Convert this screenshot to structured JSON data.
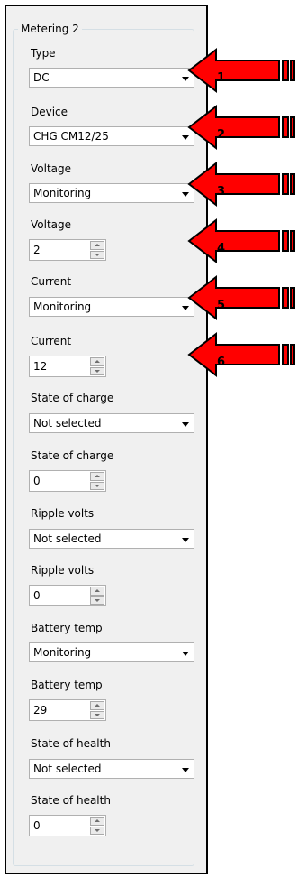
{
  "group": {
    "title": "Metering 2"
  },
  "fields": [
    {
      "label": "Type",
      "kind": "combo",
      "value": "DC"
    },
    {
      "label": "Device",
      "kind": "combo",
      "value": "CHG CM12/25"
    },
    {
      "label": "Voltage",
      "kind": "combo",
      "value": "Monitoring"
    },
    {
      "label": "Voltage",
      "kind": "spin",
      "value": "2"
    },
    {
      "label": "Current",
      "kind": "combo",
      "value": "Monitoring"
    },
    {
      "label": "Current",
      "kind": "spin",
      "value": "12"
    },
    {
      "label": "State of charge",
      "kind": "combo",
      "value": "Not selected"
    },
    {
      "label": "State of charge",
      "kind": "spin",
      "value": "0"
    },
    {
      "label": "Ripple volts",
      "kind": "combo",
      "value": "Not selected"
    },
    {
      "label": "Ripple volts",
      "kind": "spin",
      "value": "0"
    },
    {
      "label": "Battery temp",
      "kind": "combo",
      "value": "Monitoring"
    },
    {
      "label": "Battery temp",
      "kind": "spin",
      "value": "29"
    },
    {
      "label": "State of health",
      "kind": "combo",
      "value": "Not selected"
    },
    {
      "label": "State of health",
      "kind": "spin",
      "value": "0"
    }
  ],
  "callouts": [
    "1",
    "2",
    "3",
    "4",
    "5",
    "6"
  ],
  "colors": {
    "callout_fill": "#ff0000",
    "callout_stroke": "#000000",
    "panel_bg": "#f0f0f0"
  }
}
